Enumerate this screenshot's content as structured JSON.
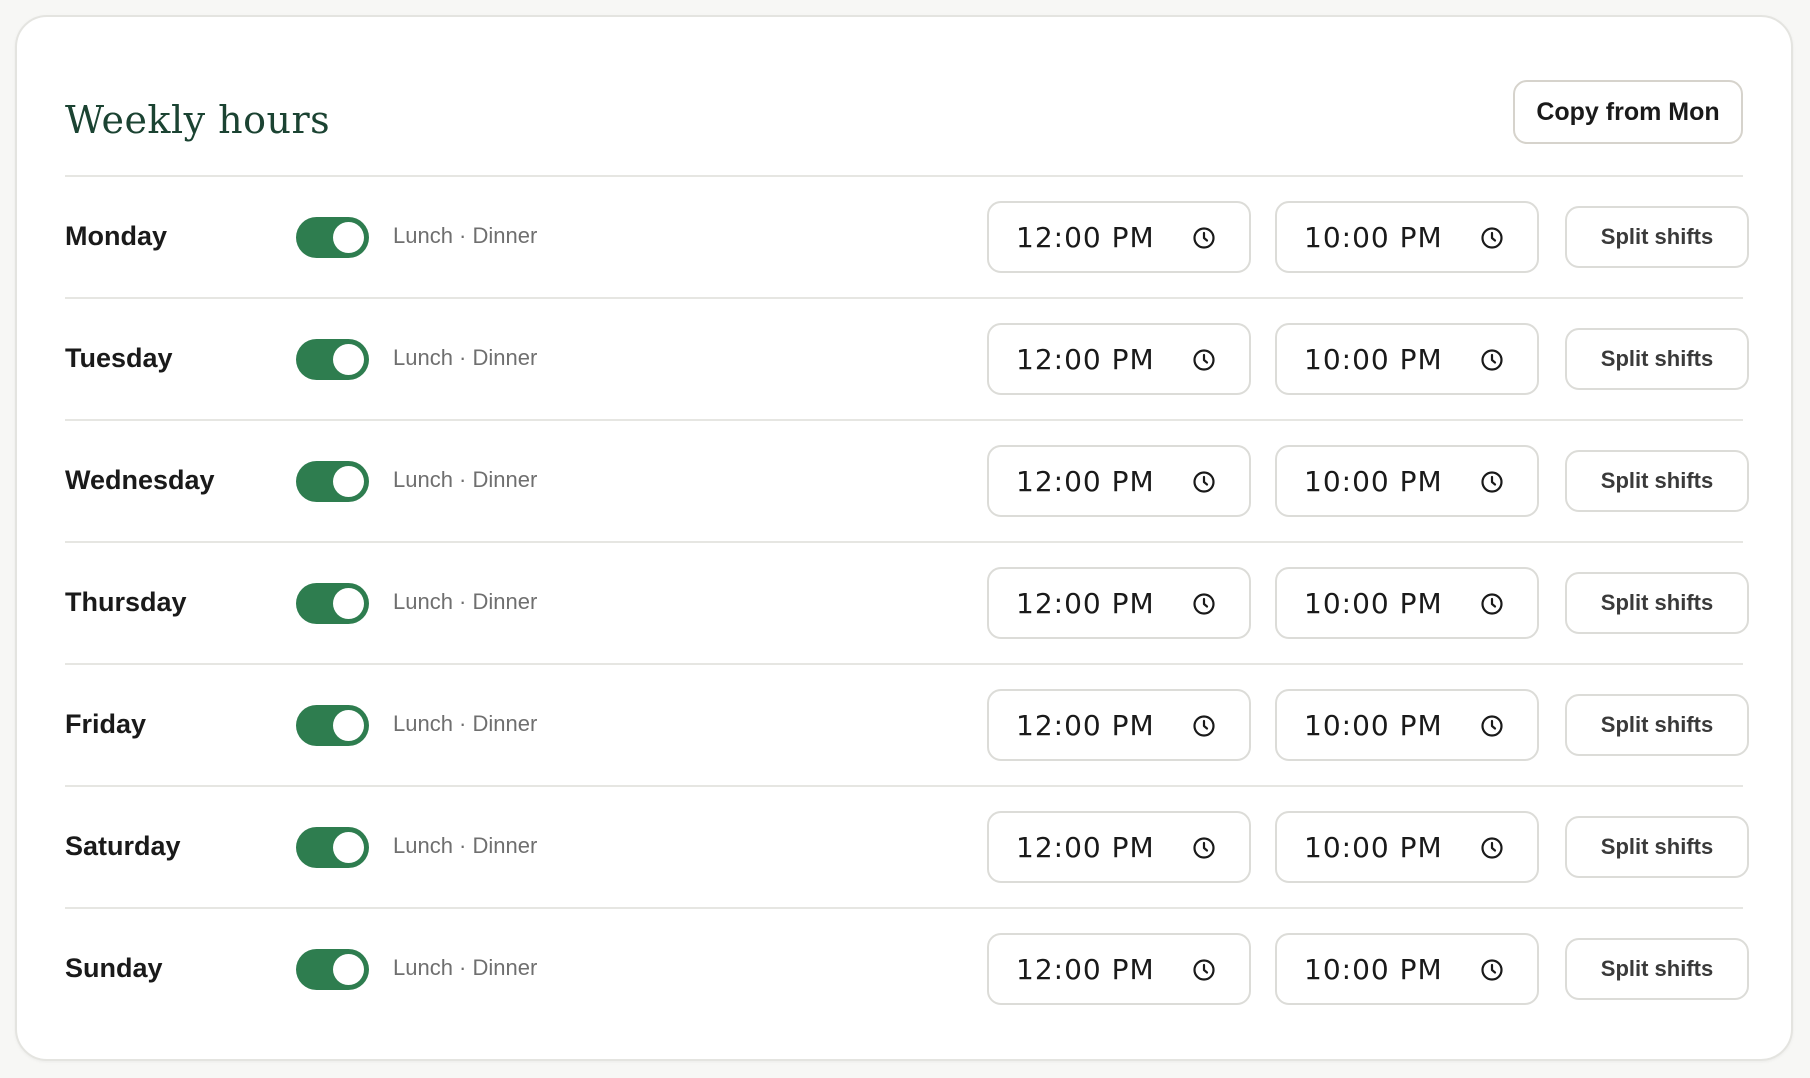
{
  "header": {
    "title": "Weekly hours",
    "copy_button_label": "Copy from Mon"
  },
  "colors": {
    "title": "#1b4332",
    "toggle_on": "#2e7d4f",
    "border": "#dcdcd8"
  },
  "days": [
    {
      "name": "Monday",
      "enabled": true,
      "meals": "Lunch · Dinner",
      "open": "12:00 PM",
      "close": "10:00 PM",
      "split_label": "Split shifts"
    },
    {
      "name": "Tuesday",
      "enabled": true,
      "meals": "Lunch · Dinner",
      "open": "12:00 PM",
      "close": "10:00 PM",
      "split_label": "Split shifts"
    },
    {
      "name": "Wednesday",
      "enabled": true,
      "meals": "Lunch · Dinner",
      "open": "12:00 PM",
      "close": "10:00 PM",
      "split_label": "Split shifts"
    },
    {
      "name": "Thursday",
      "enabled": true,
      "meals": "Lunch · Dinner",
      "open": "12:00 PM",
      "close": "10:00 PM",
      "split_label": "Split shifts"
    },
    {
      "name": "Friday",
      "enabled": true,
      "meals": "Lunch · Dinner",
      "open": "12:00 PM",
      "close": "10:00 PM",
      "split_label": "Split shifts"
    },
    {
      "name": "Saturday",
      "enabled": true,
      "meals": "Lunch · Dinner",
      "open": "12:00 PM",
      "close": "10:00 PM",
      "split_label": "Split shifts"
    },
    {
      "name": "Sunday",
      "enabled": true,
      "meals": "Lunch · Dinner",
      "open": "12:00 PM",
      "close": "10:00 PM",
      "split_label": "Split shifts"
    }
  ],
  "icons": {
    "time_field": "clock-icon"
  }
}
